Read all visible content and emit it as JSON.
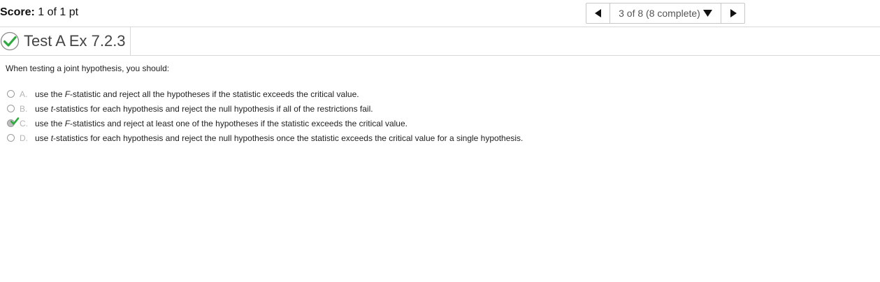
{
  "score": {
    "label": "Score:",
    "value": "1 of 1 pt"
  },
  "nav": {
    "position": "3 of 8 (8 complete)"
  },
  "title": "Test A Ex 7.2.3",
  "question": "When testing a joint hypothesis, you should:",
  "options": [
    {
      "letter": "A.",
      "pre": "use the ",
      "var": "F",
      "post": "-statistic and reject all the hypotheses if the statistic exceeds the critical value.",
      "selected": false
    },
    {
      "letter": "B.",
      "pre": "use ",
      "var": "t",
      "post": "-statistics for each hypothesis and reject the null hypothesis if all of the restrictions fail.",
      "selected": false
    },
    {
      "letter": "C.",
      "pre": "use the ",
      "var": "F",
      "post": "-statistics and reject at least one of the hypotheses if the statistic exceeds the critical value.",
      "selected": true
    },
    {
      "letter": "D.",
      "pre": "use ",
      "var": "t",
      "post": "-statistics for each hypothesis and reject the null hypothesis once the statistic exceeds the critical value for a single hypothesis.",
      "selected": false
    }
  ],
  "colors": {
    "correct_green": "#2eaa3f",
    "border": "#d9d9d9"
  }
}
